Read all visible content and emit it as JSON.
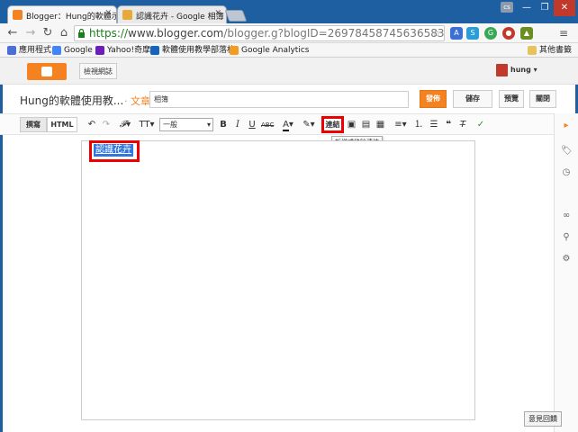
{
  "browser": {
    "tabs": [
      {
        "title": "Blogger：Hung的軟體示",
        "active": true,
        "favicon_color": "#f58220"
      },
      {
        "title": "認識花卉 - Google 相簿",
        "active": false,
        "favicon_color": "#e8a93b"
      }
    ],
    "user_badge": "cs",
    "window_controls": [
      "—",
      "❐",
      "✕"
    ],
    "url_scheme": "https://",
    "url_host": "www.blogger.com",
    "url_rest": "/blogger.g?blogID=2697845874563658378#editor/targ",
    "extensions": [
      {
        "name": "translate-icon",
        "color": "#3b6fd4",
        "label": "A"
      },
      {
        "name": "ext-sync-icon",
        "color": "#2a9dd8",
        "label": "S"
      },
      {
        "name": "ext-evernote-icon",
        "color": "#3aa757",
        "label": "G"
      },
      {
        "name": "ext-stop-icon",
        "color": "#c0392b",
        "label": "●"
      },
      {
        "name": "ext-puzzle-icon",
        "color": "#6b8e23",
        "label": "▲"
      }
    ],
    "bookmarks": [
      {
        "label": "應用程式",
        "color": "#4a6fd8"
      },
      {
        "label": "Google",
        "color": "#4285f4"
      },
      {
        "label": "Yahoo!奇摩",
        "color": "#6b1eb8"
      },
      {
        "label": "軟體使用教學部落格",
        "color": "#1565c0"
      },
      {
        "label": "Google Analytics",
        "color": "#f29d22"
      }
    ],
    "other_bookmarks": "其他書籤"
  },
  "blogger": {
    "view_blog": "檢視網誌",
    "username": "hung",
    "blog_name": "Hung的軟體使用教...",
    "posts_link": "· 文章",
    "post_title": "相簿",
    "buttons": {
      "publish": "發佈",
      "save": "儲存",
      "preview": "預覽",
      "close": "關閉"
    },
    "mode_compose": "撰寫",
    "mode_html": "HTML",
    "font_select": "一般",
    "link_button": "連結",
    "link_tooltip": "新增或移除連結",
    "selected_text": "認識花卉",
    "feedback": "意見回饋"
  }
}
